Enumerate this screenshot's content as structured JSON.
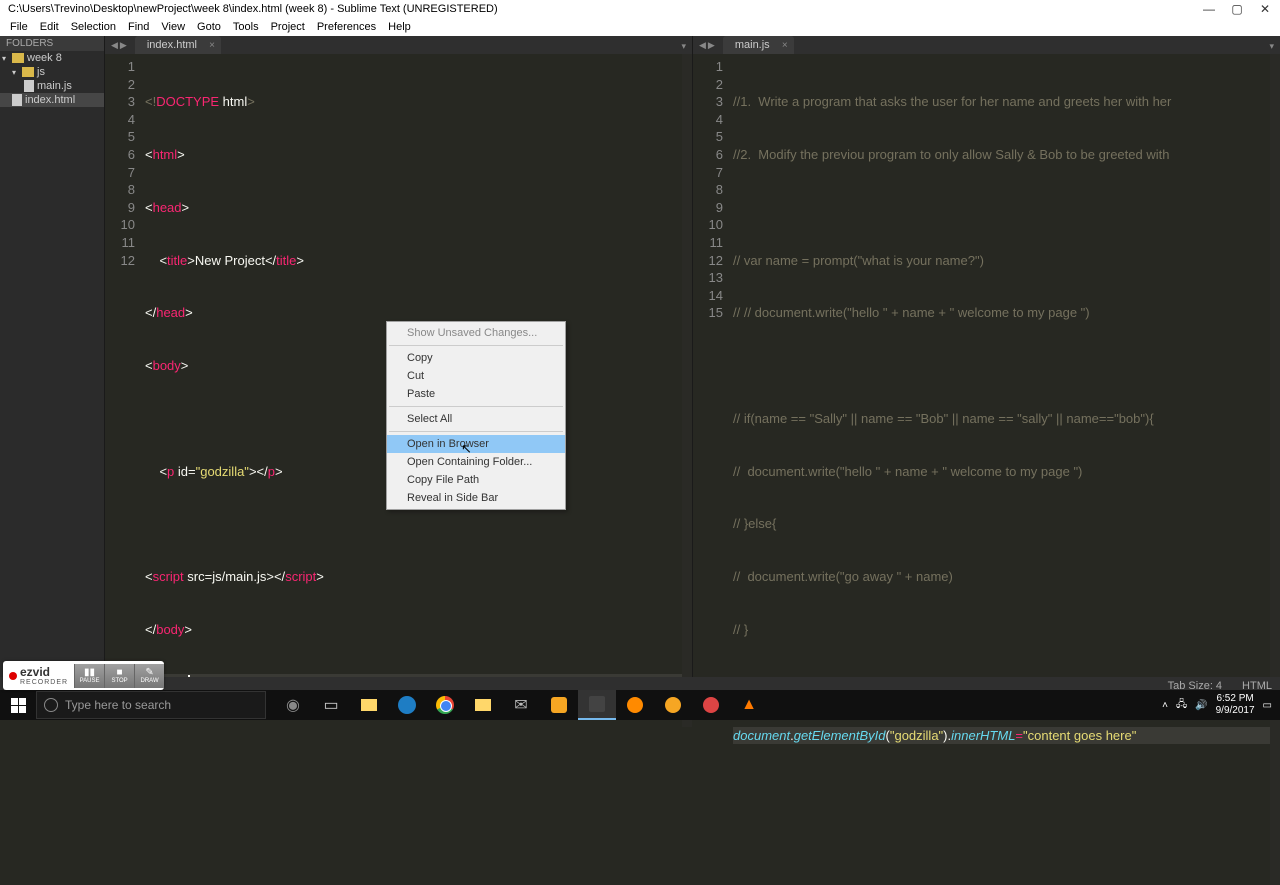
{
  "window": {
    "title": "C:\\Users\\Trevino\\Desktop\\newProject\\week 8\\index.html (week 8) - Sublime Text (UNREGISTERED)"
  },
  "menu": {
    "file": "File",
    "edit": "Edit",
    "selection": "Selection",
    "find": "Find",
    "view": "View",
    "goto": "Goto",
    "tools": "Tools",
    "project": "Project",
    "preferences": "Preferences",
    "help": "Help"
  },
  "sidebar": {
    "header": "FOLDERS",
    "root": "week 8",
    "sub": "js",
    "file1": "main.js",
    "file2": "index.html"
  },
  "tabs": {
    "left": "index.html",
    "right": "main.js"
  },
  "left_lines": [
    "1",
    "2",
    "3",
    "4",
    "5",
    "6",
    "7",
    "8",
    "9",
    "10",
    "11",
    "12"
  ],
  "right_lines": [
    "1",
    "2",
    "3",
    "4",
    "5",
    "6",
    "7",
    "8",
    "9",
    "10",
    "11",
    "12",
    "13",
    "14",
    "15"
  ],
  "code_left": {
    "doctype1": "<!",
    "doctype2": "DOCTYPE",
    "doctype3": " html",
    "doctype4": ">",
    "html_open": "html",
    "head_open": "head",
    "title_open": "title",
    "title_text": "New Project",
    "title_close": "title",
    "head_close": "head",
    "body_open": "body",
    "p_open": "<",
    "p_tag": "p",
    "p_attr": " id=",
    "p_str": "\"godzilla\"",
    "p_close1": "></",
    "p_tag2": "p",
    "p_close2": ">",
    "script_open": "script",
    "script_attr": " src=js/main.js>",
    "script_close_open": "</",
    "script_close": "script",
    "script_close_end": ">",
    "body_close": "body",
    "html_close": "html"
  },
  "code_right": {
    "c1": "//1.  Write a program that asks the user for her name and greets her with her ",
    "c2": "//2.  Modify the previou program to only allow Sally & Bob to be greeted with",
    "c4": "// var name = prompt(\"what is your name?\")",
    "c5": "// // document.write(\"hello \" + name + \" welcome to my page \")",
    "c7": "// if(name == \"Sally\" || name == \"Bob\" || name == \"sally\" || name==\"bob\"){",
    "c8": "//  document.write(\"hello \" + name + \" welcome to my page \")",
    "c9": "// }else{",
    "c10": "//  document.write(\"go away \" + name)",
    "c11": "// }",
    "l13_doc": "document",
    "l13_dot": ".",
    "l13_fn": "getElementById",
    "l13_p1": "(",
    "l13_str1": "\"godzilla\"",
    "l13_p2": ").",
    "l13_inner": "innerHTML",
    "l13_eq": "=",
    "l13_str2": "\"content goes here\""
  },
  "ctx": {
    "unsaved": "Show Unsaved Changes...",
    "copy": "Copy",
    "cut": "Cut",
    "paste": "Paste",
    "selectall": "Select All",
    "browser": "Open in Browser",
    "folder": "Open Containing Folder...",
    "filepath": "Copy File Path",
    "reveal": "Reveal in Side Bar"
  },
  "status": {
    "tabsize": "Tab Size: 4",
    "lang": "HTML"
  },
  "recorder": {
    "logo": "ezvid",
    "sub": "RECORDER",
    "pause": "PAUSE",
    "stop": "STOP",
    "draw": "DRAW"
  },
  "taskbar": {
    "search_placeholder": "Type here to search",
    "time": "6:52 PM",
    "date": "9/9/2017"
  }
}
